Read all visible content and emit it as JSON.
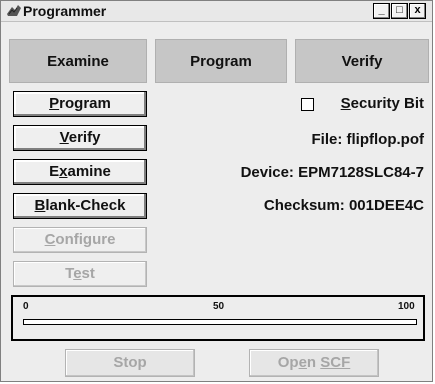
{
  "window": {
    "title": "Programmer",
    "controls": {
      "minimize": "_",
      "maximize": "□",
      "close": "x"
    }
  },
  "tabs": [
    {
      "label": "Examine"
    },
    {
      "label": "Program"
    },
    {
      "label": "Verify"
    }
  ],
  "actions": [
    {
      "accel": "P",
      "rest": "rogram",
      "enabled": true
    },
    {
      "accel": "V",
      "rest": "erify",
      "enabled": true
    },
    {
      "pre": "E",
      "accel": "x",
      "rest": "amine",
      "enabled": true
    },
    {
      "accel": "B",
      "rest": "lank-Check",
      "enabled": true
    },
    {
      "accel": "C",
      "rest": "onfigure",
      "enabled": false
    },
    {
      "pre": "T",
      "accel": "e",
      "rest": "st",
      "enabled": false
    }
  ],
  "security": {
    "accel": "S",
    "rest": "ecurity Bit",
    "checked": false
  },
  "info": {
    "file": "File: flipflop.pof",
    "device": "Device: EPM7128SLC84-7",
    "checksum": "Checksum: 001DEE4C"
  },
  "progress": {
    "ticks": [
      "0",
      "50",
      "100"
    ],
    "value": 0
  },
  "bottom_buttons": {
    "stop": "Stop",
    "open_scf_pre": "Op",
    "open_scf_accel": "e",
    "open_scf_rest": "n ",
    "open_scf_accel2": "SCF"
  },
  "colors": {
    "progress_fill": "#2a64c8",
    "disabled_text": "#a6a6a6"
  }
}
